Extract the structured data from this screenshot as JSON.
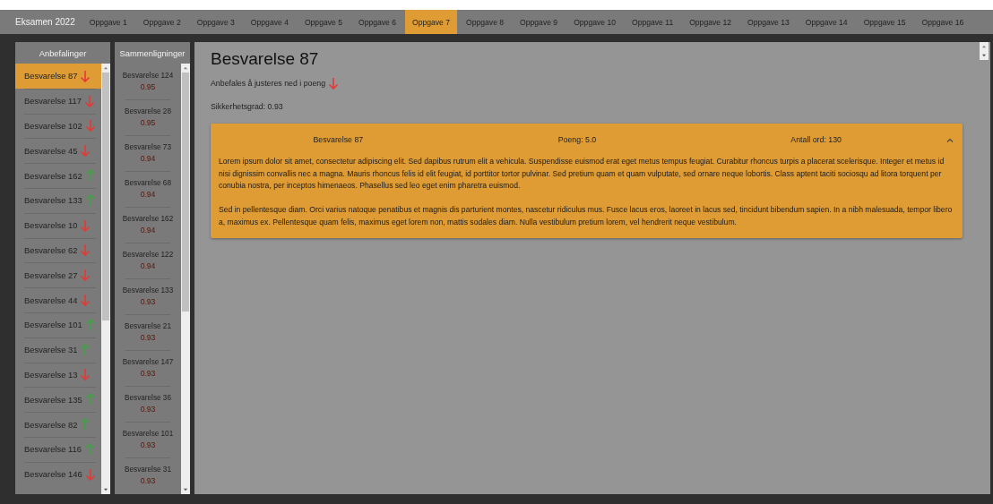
{
  "app_title": "Eksamen 2022",
  "tabs": [
    {
      "label": "Oppgave 1",
      "selected": false
    },
    {
      "label": "Oppgave 2",
      "selected": false
    },
    {
      "label": "Oppgave 3",
      "selected": false
    },
    {
      "label": "Oppgave 4",
      "selected": false
    },
    {
      "label": "Oppgave 5",
      "selected": false
    },
    {
      "label": "Oppgave 6",
      "selected": false
    },
    {
      "label": "Oppgave 7",
      "selected": true
    },
    {
      "label": "Oppgave 8",
      "selected": false
    },
    {
      "label": "Oppgave 9",
      "selected": false
    },
    {
      "label": "Oppgave 10",
      "selected": false
    },
    {
      "label": "Oppgave 11",
      "selected": false
    },
    {
      "label": "Oppgave 12",
      "selected": false
    },
    {
      "label": "Oppgave 13",
      "selected": false
    },
    {
      "label": "Oppgave 14",
      "selected": false
    },
    {
      "label": "Oppgave 15",
      "selected": false
    },
    {
      "label": "Oppgave 16",
      "selected": false
    }
  ],
  "recommendations": {
    "title": "Anbefalinger",
    "items": [
      {
        "label": "Besvarelse 87",
        "kind": "down",
        "selected": true
      },
      {
        "label": "Besvarelse 117",
        "kind": "down",
        "selected": false
      },
      {
        "label": "Besvarelse 102",
        "kind": "down",
        "selected": false
      },
      {
        "label": "Besvarelse 45",
        "kind": "down",
        "selected": false
      },
      {
        "label": "Besvarelse 162",
        "kind": "up",
        "selected": false
      },
      {
        "label": "Besvarelse 133",
        "kind": "up",
        "selected": false
      },
      {
        "label": "Besvarelse 10",
        "kind": "down",
        "selected": false
      },
      {
        "label": "Besvarelse 62",
        "kind": "down",
        "selected": false
      },
      {
        "label": "Besvarelse 27",
        "kind": "down",
        "selected": false
      },
      {
        "label": "Besvarelse 44",
        "kind": "down",
        "selected": false
      },
      {
        "label": "Besvarelse 101",
        "kind": "up",
        "selected": false
      },
      {
        "label": "Besvarelse 31",
        "kind": "up",
        "selected": false
      },
      {
        "label": "Besvarelse 13",
        "kind": "down",
        "selected": false
      },
      {
        "label": "Besvarelse 135",
        "kind": "up",
        "selected": false
      },
      {
        "label": "Besvarelse 82",
        "kind": "up",
        "selected": false
      },
      {
        "label": "Besvarelse 116",
        "kind": "up",
        "selected": false
      },
      {
        "label": "Besvarelse 146",
        "kind": "down",
        "selected": false
      }
    ]
  },
  "comparisons": {
    "title": "Sammenligninger",
    "items": [
      {
        "label": "Besvarelse 124",
        "score": "0.95"
      },
      {
        "label": "Besvarelse 28",
        "score": "0.95"
      },
      {
        "label": "Besvarelse 73",
        "score": "0.94"
      },
      {
        "label": "Besvarelse 68",
        "score": "0.94"
      },
      {
        "label": "Besvarelse 162",
        "score": "0.94"
      },
      {
        "label": "Besvarelse 122",
        "score": "0.94"
      },
      {
        "label": "Besvarelse 133",
        "score": "0.93"
      },
      {
        "label": "Besvarelse 21",
        "score": "0.93"
      },
      {
        "label": "Besvarelse 147",
        "score": "0.93"
      },
      {
        "label": "Besvarelse 36",
        "score": "0.93"
      },
      {
        "label": "Besvarelse 101",
        "score": "0.93"
      },
      {
        "label": "Besvarelse 31",
        "score": "0.93"
      }
    ]
  },
  "detail": {
    "title": "Besvarelse 87",
    "recommendation": "Anbefales å justeres ned i poeng",
    "kind": "down",
    "confidence": "Sikkerhetsgrad: 0.93",
    "card": {
      "name": "Besvarelse 87",
      "points": "Poeng: 5.0",
      "word_count": "Antall ord: 130",
      "expanded": true,
      "paragraphs": [
        "Lorem ipsum dolor sit amet, consectetur adipiscing elit. Sed dapibus rutrum elit a vehicula. Suspendisse euismod erat eget metus tempus feugiat. Curabitur rhoncus turpis a placerat scelerisque. Integer et metus id nisi dignissim convallis nec a magna. Mauris rhoncus felis id elit feugiat, id porttitor tortor pulvinar. Sed pretium quam et quam vulputate, sed ornare neque lobortis. Class aptent taciti sociosqu ad litora torquent per conubia nostra, per inceptos himenaeos. Phasellus sed leo eget enim pharetra euismod.",
        "Sed in pellentesque diam. Orci varius natoque penatibus et magnis dis parturient montes, nascetur ridiculus mus. Fusce lacus eros, laoreet in lacus sed, tincidunt bibendum sapien. In a nibh malesuada, tempor libero a, maximus ex. Pellentesque quam felis, maximus eget lorem non, mattis sodales diam. Nulla vestibulum pretium lorem, vel hendrerit neque vestibulum."
      ]
    }
  }
}
